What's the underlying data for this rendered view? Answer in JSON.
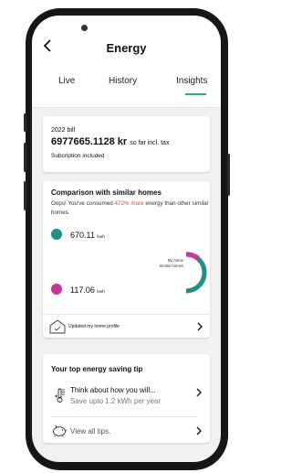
{
  "header": {
    "back_icon": "chevron-left-icon",
    "title": "Energy",
    "tabs": [
      {
        "label": "Live",
        "active": false
      },
      {
        "label": "History",
        "active": false
      },
      {
        "label": "Insights",
        "active": true
      }
    ],
    "accent_color": "#27b36a"
  },
  "bill_card": {
    "year_label": "2022 bill",
    "amount": "6977665.1128 kr",
    "amount_suffix": "so far incl. tax",
    "subscription": "Subcription included"
  },
  "comparison_card": {
    "title": "Comparison with similar homes",
    "text_before": "Oops! You've consumed ",
    "text_highlight": "472% more",
    "text_after": " energy than other similar homes.",
    "my_home": {
      "value": "670.11",
      "unit": "kwh",
      "color": "#1f8f8a",
      "label": "My home"
    },
    "similar_homes": {
      "value": "117.06",
      "unit": "kwh",
      "color": "#c9359c",
      "label": "Similar homes"
    },
    "profile_link": "Updated my home profile",
    "profile_icon": "house-icon"
  },
  "tip_card": {
    "title": "Your top energy saving tip",
    "tip_icon": "thermometer-icon",
    "tip_title": "Think about how you will...",
    "tip_subtitle": "Save upto 1.2 kWh per year",
    "view_all_icon": "piggy-bank-icon",
    "view_all": "View all tips."
  }
}
